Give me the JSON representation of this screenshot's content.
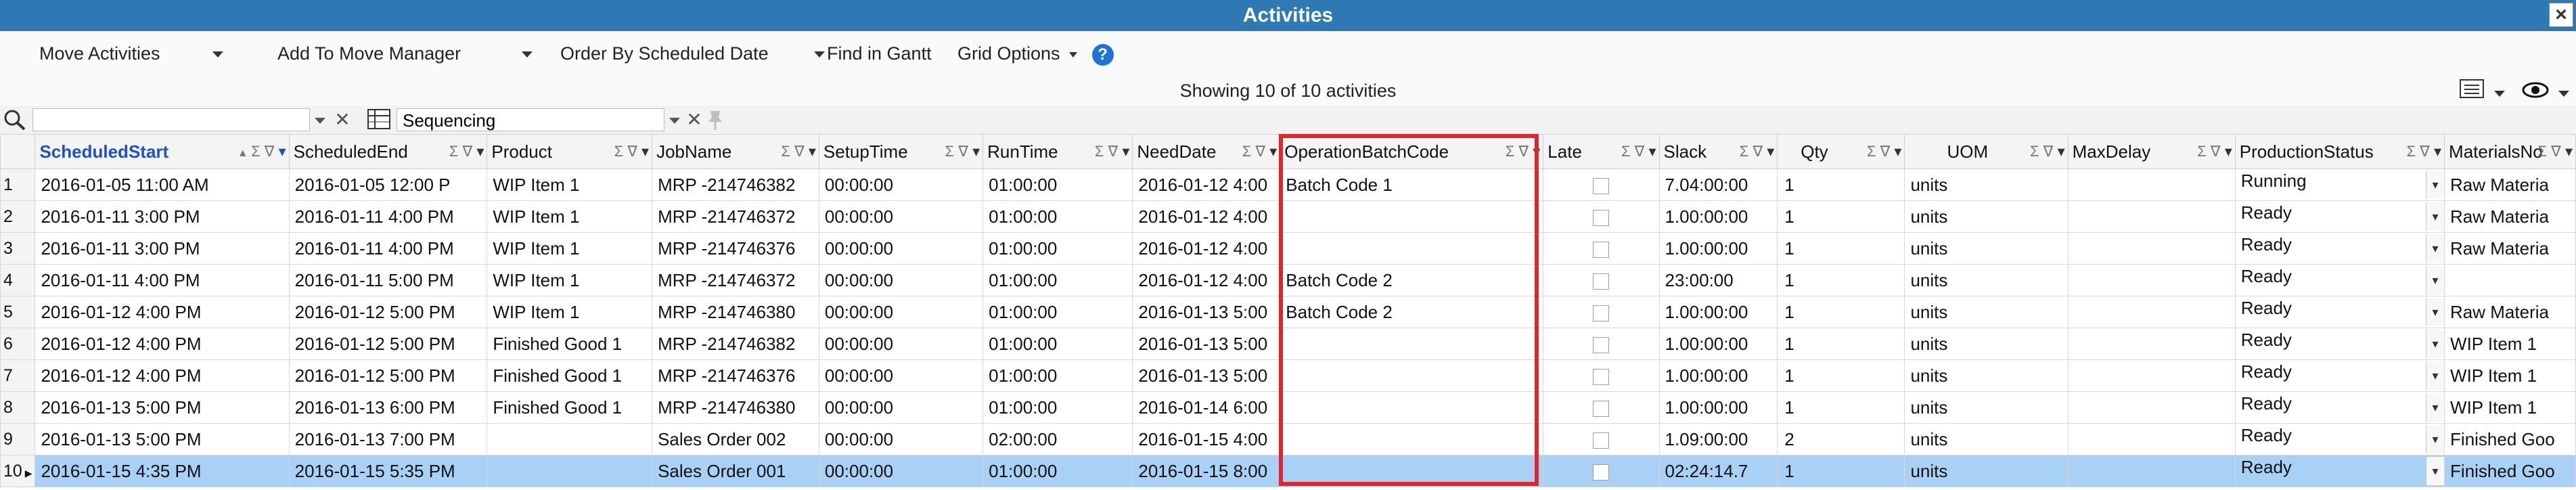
{
  "window": {
    "title": "Activities",
    "close_glyph": "×"
  },
  "toolbar": {
    "move_activities": "Move Activities",
    "add_to_move_manager": "Add To Move Manager",
    "order_by": "Order By Scheduled Date",
    "find_in_gantt": "Find in Gantt",
    "grid_options": "Grid Options",
    "help_glyph": "?"
  },
  "status": {
    "showing": "Showing 10 of 10 activities"
  },
  "filter": {
    "search_value": "",
    "layout_name": "Sequencing"
  },
  "columns": [
    {
      "label": "ScheduledStart",
      "sorted": true
    },
    {
      "label": "ScheduledEnd"
    },
    {
      "label": "Product"
    },
    {
      "label": "JobName"
    },
    {
      "label": "SetupTime"
    },
    {
      "label": "RunTime"
    },
    {
      "label": "NeedDate"
    },
    {
      "label": "OperationBatchCode",
      "highlighted": true
    },
    {
      "label": "Late"
    },
    {
      "label": "Slack"
    },
    {
      "label": "Qty"
    },
    {
      "label": "UOM"
    },
    {
      "label": "MaxDelay"
    },
    {
      "label": "ProductionStatus"
    },
    {
      "label": "MaterialsNo"
    }
  ],
  "rows": [
    {
      "n": "1",
      "start": "2016-01-05 11:00 AM",
      "end": "2016-01-05 12:00 P",
      "product": "WIP Item 1",
      "job": "MRP -214746382",
      "setup": "00:00:00",
      "run": "01:00:00",
      "need": "2016-01-12 4:00",
      "batch": "Batch Code 1",
      "slack": "7.04:00:00",
      "qty": "1",
      "uom": "units",
      "maxdelay": "",
      "status": "Running",
      "materials": "Raw Materia"
    },
    {
      "n": "2",
      "start": "2016-01-11 3:00 PM",
      "end": "2016-01-11 4:00 PM",
      "product": "WIP Item 1",
      "job": "MRP -214746372",
      "setup": "00:00:00",
      "run": "01:00:00",
      "need": "2016-01-12 4:00",
      "batch": "",
      "slack": "1.00:00:00",
      "qty": "1",
      "uom": "units",
      "maxdelay": "",
      "status": "Ready",
      "materials": "Raw Materia"
    },
    {
      "n": "3",
      "start": "2016-01-11 3:00 PM",
      "end": "2016-01-11 4:00 PM",
      "product": "WIP Item 1",
      "job": "MRP -214746376",
      "setup": "00:00:00",
      "run": "01:00:00",
      "need": "2016-01-12 4:00",
      "batch": "",
      "slack": "1.00:00:00",
      "qty": "1",
      "uom": "units",
      "maxdelay": "",
      "status": "Ready",
      "materials": "Raw Materia"
    },
    {
      "n": "4",
      "start": "2016-01-11 4:00 PM",
      "end": "2016-01-11 5:00 PM",
      "product": "WIP Item 1",
      "job": "MRP -214746372",
      "setup": "00:00:00",
      "run": "01:00:00",
      "need": "2016-01-12 4:00",
      "batch": "Batch Code 2",
      "slack": "23:00:00",
      "qty": "1",
      "uom": "units",
      "maxdelay": "",
      "status": "Ready",
      "materials": ""
    },
    {
      "n": "5",
      "start": "2016-01-12 4:00 PM",
      "end": "2016-01-12 5:00 PM",
      "product": "WIP Item 1",
      "job": "MRP -214746380",
      "setup": "00:00:00",
      "run": "01:00:00",
      "need": "2016-01-13 5:00",
      "batch": "Batch Code 2",
      "slack": "1.00:00:00",
      "qty": "1",
      "uom": "units",
      "maxdelay": "",
      "status": "Ready",
      "materials": "Raw Materia"
    },
    {
      "n": "6",
      "start": "2016-01-12 4:00 PM",
      "end": "2016-01-12 5:00 PM",
      "product": "Finished Good 1",
      "job": "MRP -214746382",
      "setup": "00:00:00",
      "run": "01:00:00",
      "need": "2016-01-13 5:00",
      "batch": "",
      "slack": "1.00:00:00",
      "qty": "1",
      "uom": "units",
      "maxdelay": "",
      "status": "Ready",
      "materials": "WIP Item 1"
    },
    {
      "n": "7",
      "start": "2016-01-12 4:00 PM",
      "end": "2016-01-12 5:00 PM",
      "product": "Finished Good 1",
      "job": "MRP -214746376",
      "setup": "00:00:00",
      "run": "01:00:00",
      "need": "2016-01-13 5:00",
      "batch": "",
      "slack": "1.00:00:00",
      "qty": "1",
      "uom": "units",
      "maxdelay": "",
      "status": "Ready",
      "materials": "WIP Item 1"
    },
    {
      "n": "8",
      "start": "2016-01-13 5:00 PM",
      "end": "2016-01-13 6:00 PM",
      "product": "Finished Good 1",
      "job": "MRP -214746380",
      "setup": "00:00:00",
      "run": "01:00:00",
      "need": "2016-01-14 6:00",
      "batch": "",
      "slack": "1.00:00:00",
      "qty": "1",
      "uom": "units",
      "maxdelay": "",
      "status": "Ready",
      "materials": "WIP Item 1"
    },
    {
      "n": "9",
      "start": "2016-01-13 5:00 PM",
      "end": "2016-01-13 7:00 PM",
      "product": "",
      "job": "Sales Order 002",
      "setup": "00:00:00",
      "run": "02:00:00",
      "need": "2016-01-15 4:00",
      "batch": "",
      "slack": "1.09:00:00",
      "qty": "2",
      "uom": "units",
      "maxdelay": "",
      "status": "Ready",
      "materials": "Finished Goo"
    },
    {
      "n": "10",
      "start": "2016-01-15 4:35 PM",
      "end": "2016-01-15 5:35 PM",
      "product": "",
      "job": "Sales Order 001",
      "setup": "00:00:00",
      "run": "01:00:00",
      "need": "2016-01-15 8:00",
      "batch": "",
      "slack": "02:24:14.7",
      "qty": "1",
      "uom": "units",
      "maxdelay": "",
      "status": "Ready",
      "materials": "Finished Goo",
      "selected": true
    }
  ],
  "colors": {
    "title_bar": "#2e79b3",
    "selected_row": "#a9d1f5",
    "highlight_box": "#e0252f",
    "sorted_header": "#1e50c8"
  },
  "icons": [
    "close-icon",
    "chevron-down-icon",
    "help-icon",
    "search-icon",
    "clear-icon",
    "layout-grid-icon",
    "pin-icon",
    "column-chooser-icon",
    "eye-icon",
    "sort-icon",
    "sum-icon",
    "filter-icon",
    "checkbox-icon",
    "row-pointer-icon"
  ]
}
